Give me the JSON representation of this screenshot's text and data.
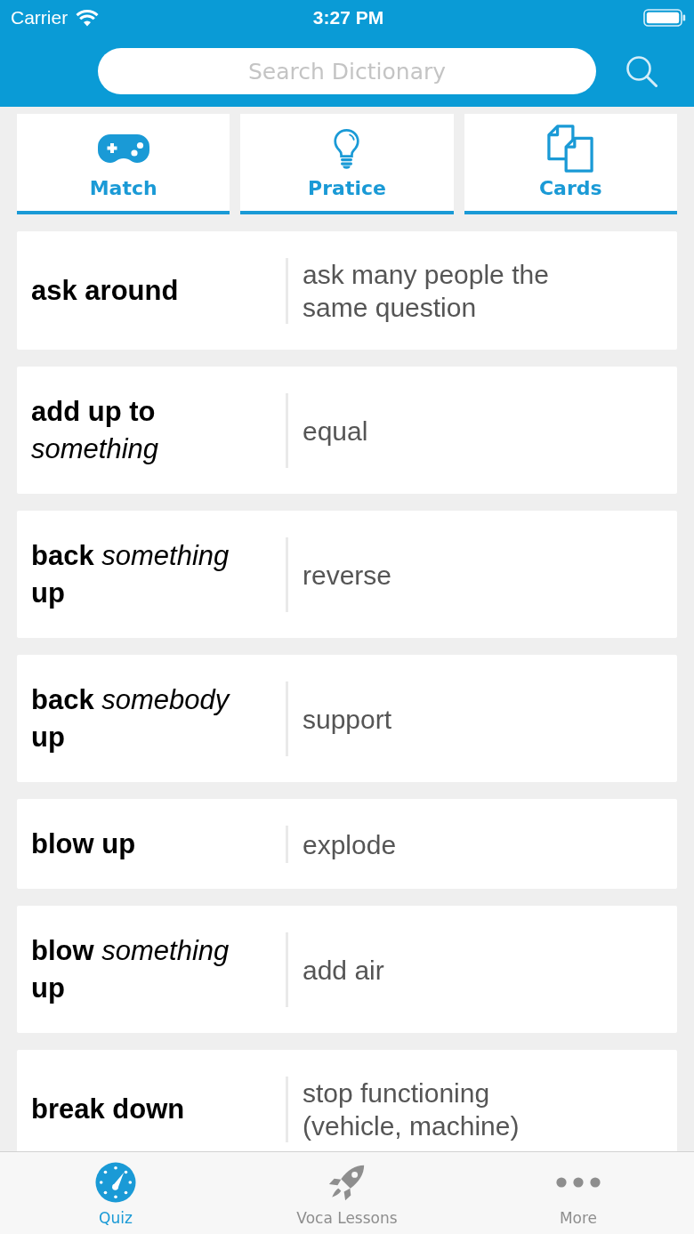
{
  "status_bar": {
    "carrier": "Carrier",
    "time": "3:27 PM"
  },
  "search": {
    "placeholder": "Search Dictionary"
  },
  "modes": [
    {
      "label": "Match"
    },
    {
      "label": "Pratice"
    },
    {
      "label": "Cards"
    }
  ],
  "entries": [
    {
      "term": "ask around",
      "definition": "ask many people the same question"
    },
    {
      "term": "add up to *something*",
      "definition": "equal"
    },
    {
      "term": "back *something* up",
      "definition": "reverse"
    },
    {
      "term": "back *somebody* up",
      "definition": "support"
    },
    {
      "term": "blow up",
      "definition": "explode"
    },
    {
      "term": "blow *something* up",
      "definition": "add air"
    },
    {
      "term": "break down",
      "definition": "stop functioning (vehicle, machine)"
    }
  ],
  "tab_bar": [
    {
      "label": "Quiz",
      "selected": true
    },
    {
      "label": "Voca Lessons",
      "selected": false
    },
    {
      "label": "More",
      "selected": false
    }
  ]
}
